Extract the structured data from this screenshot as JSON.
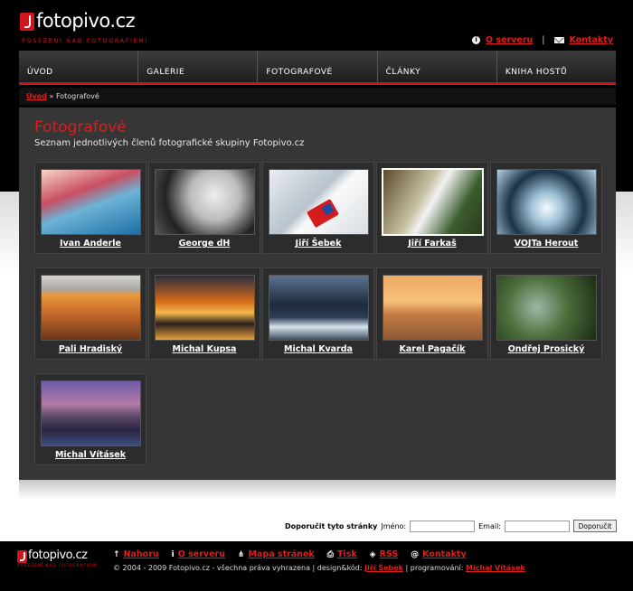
{
  "logo": {
    "text": "fotopivo.cz",
    "tagline": "POSEZENÍ NAD FOTOGRAFIEMI"
  },
  "top_links": {
    "about": "O serveru",
    "contacts": "Kontakty"
  },
  "nav": [
    "ÚVOD",
    "GALERIE",
    "FOTOGRAFOVÉ",
    "ČLÁNKY",
    "KNIHA HOSTŮ"
  ],
  "breadcrumb": {
    "home": "Úvod",
    "sep": "»",
    "current": "Fotografové"
  },
  "main": {
    "title": "Fotografové",
    "subtitle": "Seznam jednotlivých členů fotografické skupiny Fotopivo.cz"
  },
  "photographers": [
    {
      "name": "Ivan Anderle"
    },
    {
      "name": "George dH"
    },
    {
      "name": "Jiří Šebek"
    },
    {
      "name": "Jiří Farkaš"
    },
    {
      "name": "VOJTa Herout"
    },
    {
      "name": "Pali Hradiský"
    },
    {
      "name": "Michal Kupsa"
    },
    {
      "name": "Michal Kvarda"
    },
    {
      "name": "Karel Pagačík"
    },
    {
      "name": "Ondřej Prosický"
    },
    {
      "name": "Michal Vításek"
    }
  ],
  "recommend": {
    "label": "Doporučit tyto stránky",
    "name_label": "Jméno:",
    "email_label": "Email:",
    "button": "Doporučit"
  },
  "footer": {
    "links": [
      "Nahoru",
      "O serveru",
      "Mapa stránek",
      "Tisk",
      "RSS",
      "Kontakty"
    ],
    "copyright": "© 2004 - 2009 Fotopivo.cz - všechna práva vyhrazena | design&kód:",
    "design_author": "Jiří Šebek",
    "programming_label": "| programování:",
    "programmer": "Michal Vításek"
  },
  "colors": {
    "accent": "#e11b1b",
    "background": "#000000",
    "panel": "#363636"
  }
}
